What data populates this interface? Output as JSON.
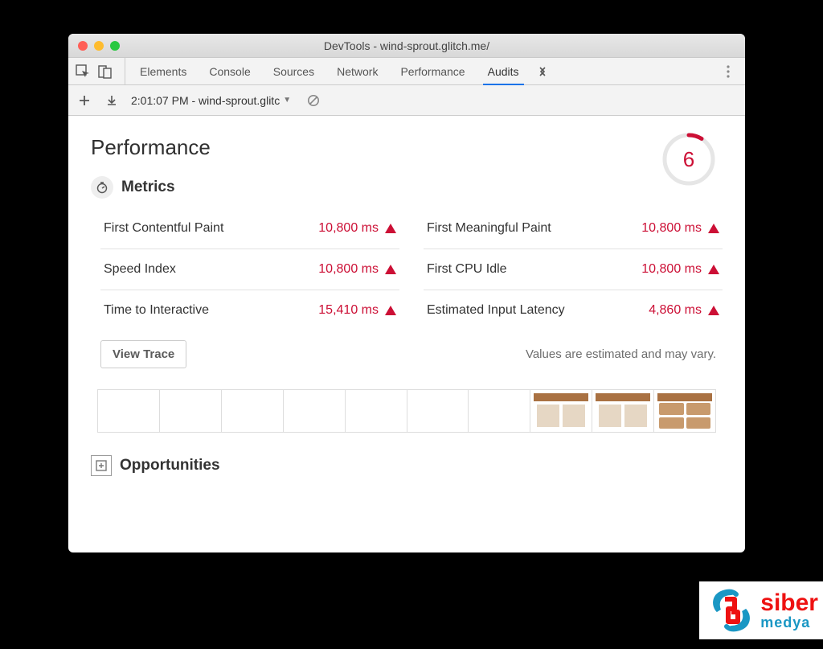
{
  "window": {
    "title": "DevTools - wind-sprout.glitch.me/"
  },
  "tabs": [
    "Elements",
    "Console",
    "Sources",
    "Network",
    "Performance",
    "Audits"
  ],
  "active_tab": "Audits",
  "subbar": {
    "selector": "2:01:07 PM - wind-sprout.glitc"
  },
  "audit": {
    "title": "Performance",
    "score": "6",
    "metrics_label": "Metrics",
    "metrics_left": [
      {
        "label": "First Contentful Paint",
        "value": "10,800 ms"
      },
      {
        "label": "Speed Index",
        "value": "10,800 ms"
      },
      {
        "label": "Time to Interactive",
        "value": "15,410 ms"
      }
    ],
    "metrics_right": [
      {
        "label": "First Meaningful Paint",
        "value": "10,800 ms"
      },
      {
        "label": "First CPU Idle",
        "value": "10,800 ms"
      },
      {
        "label": "Estimated Input Latency",
        "value": "4,860 ms"
      }
    ],
    "view_trace": "View Trace",
    "estimate_note": "Values are estimated and may vary.",
    "opportunities_label": "Opportunities"
  },
  "branding": {
    "line1": "siber",
    "line2": "medya"
  }
}
